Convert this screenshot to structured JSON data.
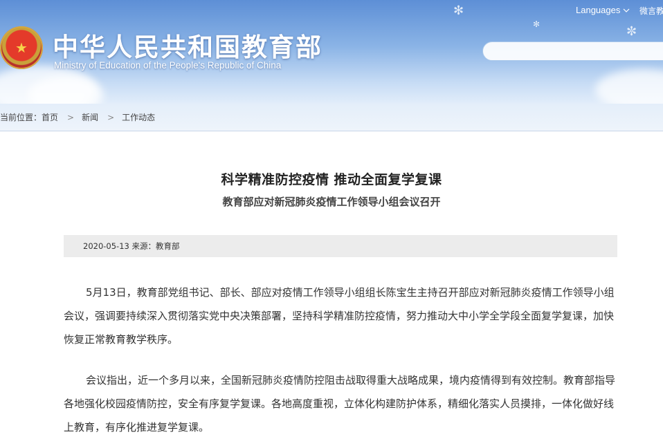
{
  "header": {
    "title": "中华人民共和国教育部",
    "subtitle": "Ministry of Education of the People's Republic of China",
    "languages_label": "Languages",
    "weibo_label": "微言教",
    "search_placeholder": ""
  },
  "breadcrumb": {
    "prefix": "当前位置：",
    "items": [
      "首页",
      "新闻",
      "工作动态"
    ],
    "separator": ">"
  },
  "article": {
    "title": "科学精准防控疫情 推动全面复学复课",
    "subtitle": "教育部应对新冠肺炎疫情工作领导小组会议召开",
    "meta": "2020-05-13 来源：教育部",
    "paragraphs": [
      "5月13日，教育部党组书记、部长、部应对疫情工作领导小组组长陈宝生主持召开部应对新冠肺炎疫情工作领导小组会议，强调要持续深入贯彻落实党中央决策部署，坚持科学精准防控疫情，努力推动大中小学全学段全面复学复课，加快恢复正常教育教学秩序。",
      "会议指出，近一个多月以来，全国新冠肺炎疫情防控阻击战取得重大战略成果，境内疫情得到有效控制。教育部指导各地强化校园疫情防控，安全有序复学复课。各地高度重视，立体化构建防护体系，精细化落实人员摸排，一体化做好线上教育，有序化推进复学复课。"
    ]
  },
  "colors": {
    "header_sky": "#8bb4e6",
    "breadcrumb_bg": "#e8f0fa",
    "meta_bg": "#ececec",
    "emblem_red": "#e43a2a",
    "emblem_gold": "#f6d24a"
  }
}
